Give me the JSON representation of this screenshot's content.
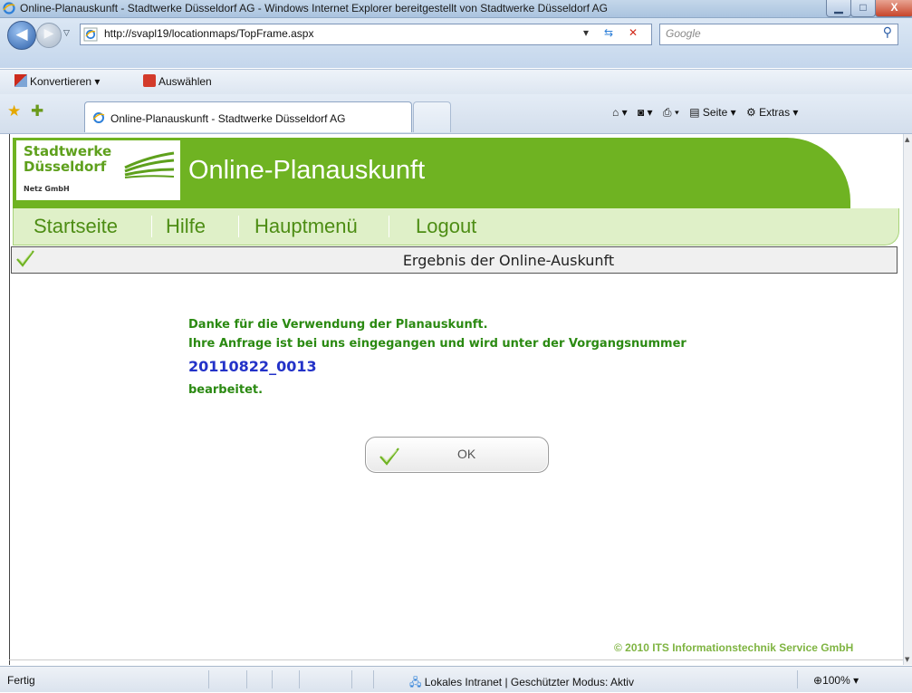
{
  "window": {
    "title": "Online-Planauskunft - Stadtwerke Düsseldorf AG - Windows Internet Explorer bereitgestellt von Stadtwerke Düsseldorf AG",
    "minimize_icon": "minimize-icon",
    "maximize_icon": "maximize-icon",
    "close_label": "X"
  },
  "addressbar": {
    "url": "http://svapl19/locationmaps/TopFrame.aspx",
    "search_placeholder": "Google"
  },
  "linksbar": {
    "convert_label": "Konvertieren",
    "select_label": "Auswählen"
  },
  "tabs": {
    "active_label": "Online-Planauskunft - Stadtwerke Düsseldorf AG"
  },
  "commandbar": {
    "page_label": "Seite",
    "tools_label": "Extras"
  },
  "header": {
    "logo_line1": "Stadtwerke",
    "logo_line2": "Düsseldorf",
    "logo_sub": "Netz GmbH",
    "app_title": "Online-Planauskunft",
    "brand_color": "#6fb322"
  },
  "nav": {
    "items": [
      "Startseite",
      "Hilfe",
      "Hauptmenü",
      "Logout"
    ]
  },
  "result": {
    "title": "Ergebnis der Online-Auskunft",
    "line1": "Danke für die Verwendung der Planauskunft.",
    "line2": "Ihre Anfrage ist bei uns eingegangen und wird unter der Vorgangsnummer",
    "case_number": "20110822_0013",
    "line3": "bearbeitet.",
    "ok_label": "OK"
  },
  "footer": {
    "copyright": "© 2010 ITS Informationstechnik Service GmbH"
  },
  "statusbar": {
    "status": "Fertig",
    "zone": "Lokales Intranet | Geschützter Modus: Aktiv",
    "zoom": "100%"
  }
}
